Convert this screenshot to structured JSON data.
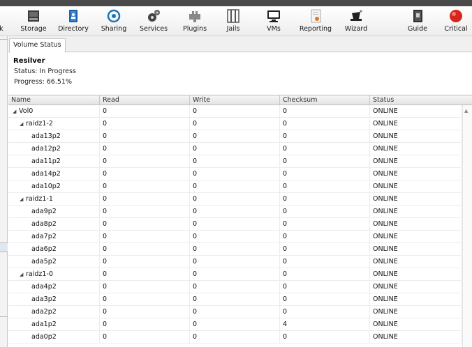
{
  "toolbar": {
    "items": [
      {
        "label": "rk",
        "icon": "network-icon"
      },
      {
        "label": "Storage",
        "icon": "storage-icon"
      },
      {
        "label": "Directory",
        "icon": "directory-icon"
      },
      {
        "label": "Sharing",
        "icon": "sharing-icon"
      },
      {
        "label": "Services",
        "icon": "services-icon"
      },
      {
        "label": "Plugins",
        "icon": "plugins-icon"
      },
      {
        "label": "Jails",
        "icon": "jails-icon"
      },
      {
        "label": "VMs",
        "icon": "vms-icon"
      },
      {
        "label": "Reporting",
        "icon": "reporting-icon"
      },
      {
        "label": "Wizard",
        "icon": "wizard-icon"
      },
      {
        "label": "Guide",
        "icon": "guide-icon"
      },
      {
        "label": "Critical",
        "icon": "critical-alert-icon",
        "color": "#d9261c"
      }
    ]
  },
  "tab": {
    "label": "Volume Status"
  },
  "resilver": {
    "title": "Resilver",
    "status": "Status: In Progress",
    "progress": "Progress: 66.51%"
  },
  "grid": {
    "columns": [
      "Name",
      "Read",
      "Write",
      "Checksum",
      "Status"
    ],
    "rows": [
      {
        "name": "Vol0",
        "level": 0,
        "expander": true,
        "read": "0",
        "write": "0",
        "checksum": "0",
        "status": "ONLINE"
      },
      {
        "name": "raidz1-2",
        "level": 1,
        "expander": true,
        "read": "0",
        "write": "0",
        "checksum": "0",
        "status": "ONLINE"
      },
      {
        "name": "ada13p2",
        "level": 2,
        "expander": false,
        "read": "0",
        "write": "0",
        "checksum": "0",
        "status": "ONLINE"
      },
      {
        "name": "ada12p2",
        "level": 2,
        "expander": false,
        "read": "0",
        "write": "0",
        "checksum": "0",
        "status": "ONLINE"
      },
      {
        "name": "ada11p2",
        "level": 2,
        "expander": false,
        "read": "0",
        "write": "0",
        "checksum": "0",
        "status": "ONLINE"
      },
      {
        "name": "ada14p2",
        "level": 2,
        "expander": false,
        "read": "0",
        "write": "0",
        "checksum": "0",
        "status": "ONLINE"
      },
      {
        "name": "ada10p2",
        "level": 2,
        "expander": false,
        "read": "0",
        "write": "0",
        "checksum": "0",
        "status": "ONLINE"
      },
      {
        "name": "raidz1-1",
        "level": 1,
        "expander": true,
        "read": "0",
        "write": "0",
        "checksum": "0",
        "status": "ONLINE"
      },
      {
        "name": "ada9p2",
        "level": 2,
        "expander": false,
        "read": "0",
        "write": "0",
        "checksum": "0",
        "status": "ONLINE"
      },
      {
        "name": "ada8p2",
        "level": 2,
        "expander": false,
        "read": "0",
        "write": "0",
        "checksum": "0",
        "status": "ONLINE"
      },
      {
        "name": "ada7p2",
        "level": 2,
        "expander": false,
        "read": "0",
        "write": "0",
        "checksum": "0",
        "status": "ONLINE"
      },
      {
        "name": "ada6p2",
        "level": 2,
        "expander": false,
        "read": "0",
        "write": "0",
        "checksum": "0",
        "status": "ONLINE"
      },
      {
        "name": "ada5p2",
        "level": 2,
        "expander": false,
        "read": "0",
        "write": "0",
        "checksum": "0",
        "status": "ONLINE"
      },
      {
        "name": "raidz1-0",
        "level": 1,
        "expander": true,
        "read": "0",
        "write": "0",
        "checksum": "0",
        "status": "ONLINE"
      },
      {
        "name": "ada4p2",
        "level": 2,
        "expander": false,
        "read": "0",
        "write": "0",
        "checksum": "0",
        "status": "ONLINE"
      },
      {
        "name": "ada3p2",
        "level": 2,
        "expander": false,
        "read": "0",
        "write": "0",
        "checksum": "0",
        "status": "ONLINE"
      },
      {
        "name": "ada2p2",
        "level": 2,
        "expander": false,
        "read": "0",
        "write": "0",
        "checksum": "0",
        "status": "ONLINE"
      },
      {
        "name": "ada1p2",
        "level": 2,
        "expander": false,
        "read": "0",
        "write": "0",
        "checksum": "4",
        "status": "ONLINE"
      },
      {
        "name": "ada0p2",
        "level": 2,
        "expander": false,
        "read": "0",
        "write": "0",
        "checksum": "0",
        "status": "ONLINE"
      }
    ]
  }
}
